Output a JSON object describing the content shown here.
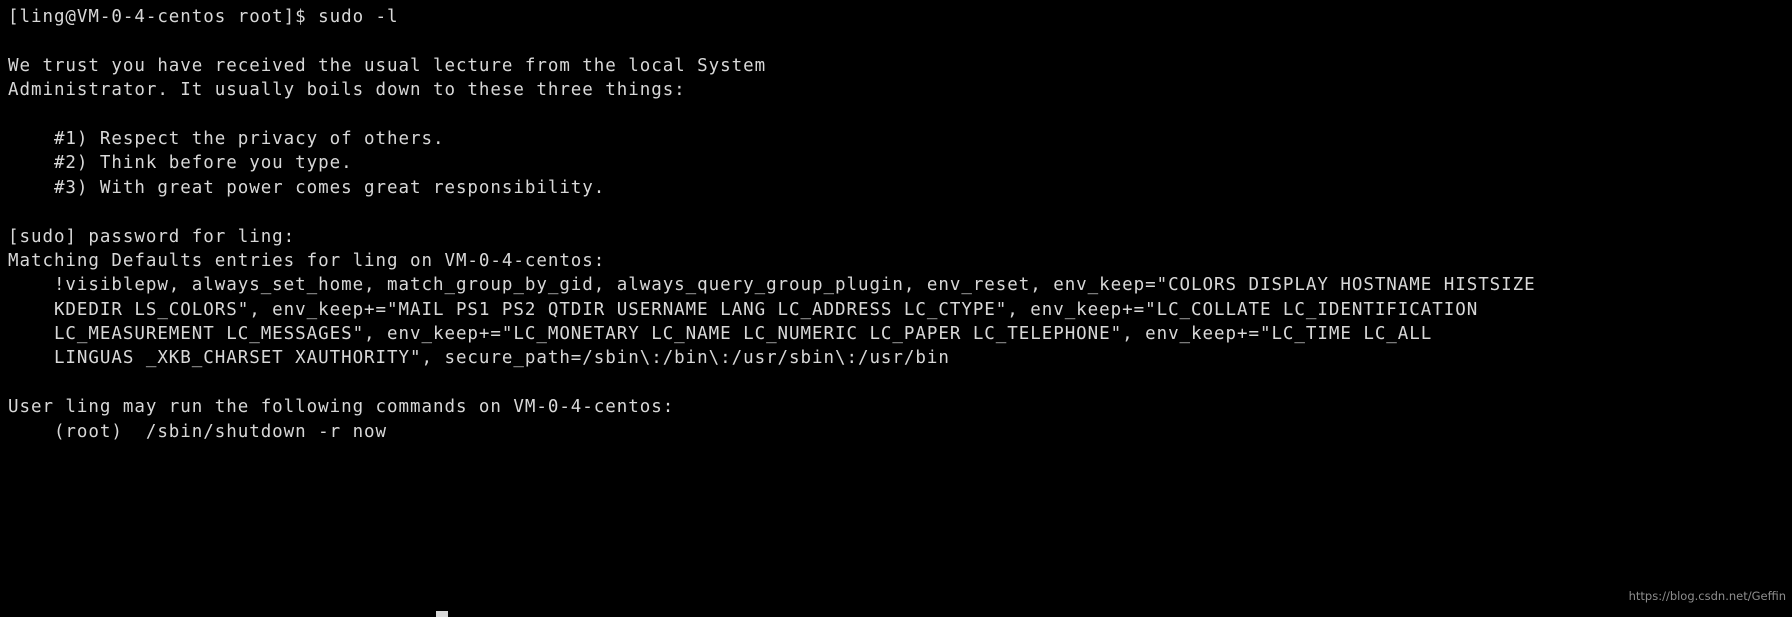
{
  "terminal": {
    "colors": {
      "background": "#000000",
      "foreground": "#d8d8d8",
      "watermark": "#8d8d8d"
    },
    "prompt": {
      "user": "ling",
      "host": "VM-0-4-centos",
      "cwd": "root",
      "symbol": "$",
      "command": "sudo -l",
      "full": "[ling@VM-0-4-centos root]$ sudo -l"
    },
    "lines": [
      "[ling@VM-0-4-centos root]$ sudo -l",
      "",
      "We trust you have received the usual lecture from the local System",
      "Administrator. It usually boils down to these three things:",
      "",
      "    #1) Respect the privacy of others.",
      "    #2) Think before you type.",
      "    #3) With great power comes great responsibility.",
      "",
      "[sudo] password for ling:",
      "Matching Defaults entries for ling on VM-0-4-centos:",
      "    !visiblepw, always_set_home, match_group_by_gid, always_query_group_plugin, env_reset, env_keep=\"COLORS DISPLAY HOSTNAME HISTSIZE",
      "    KDEDIR LS_COLORS\", env_keep+=\"MAIL PS1 PS2 QTDIR USERNAME LANG LC_ADDRESS LC_CTYPE\", env_keep+=\"LC_COLLATE LC_IDENTIFICATION",
      "    LC_MEASUREMENT LC_MESSAGES\", env_keep+=\"LC_MONETARY LC_NAME LC_NUMERIC LC_PAPER LC_TELEPHONE\", env_keep+=\"LC_TIME LC_ALL",
      "    LINGUAS _XKB_CHARSET XAUTHORITY\", secure_path=/sbin\\:/bin\\:/usr/sbin\\:/usr/bin",
      "",
      "User ling may run the following commands on VM-0-4-centos:",
      "    (root)  /sbin/shutdown -r now"
    ],
    "watermark": "https://blog.csdn.net/Geffin"
  }
}
